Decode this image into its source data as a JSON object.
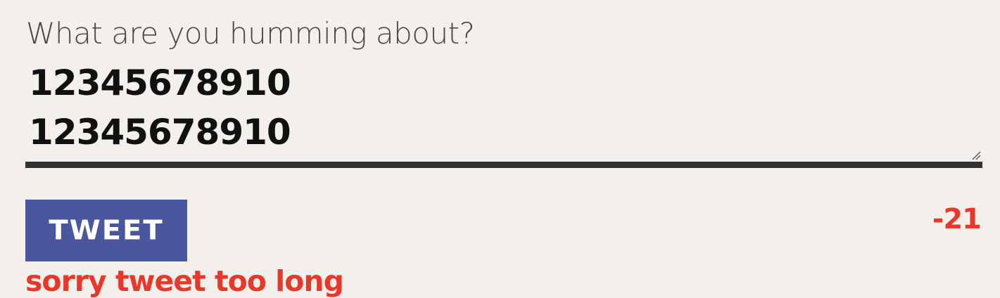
{
  "composer": {
    "prompt": "What are you humming about?",
    "text_lines": [
      "12345678910",
      "12345678910"
    ]
  },
  "actions": {
    "tweet_label": "TWEET"
  },
  "status": {
    "remaining_count": "-21",
    "error_message": "sorry tweet too long",
    "error_color": "#e8382c",
    "button_color": "#4a569d"
  }
}
